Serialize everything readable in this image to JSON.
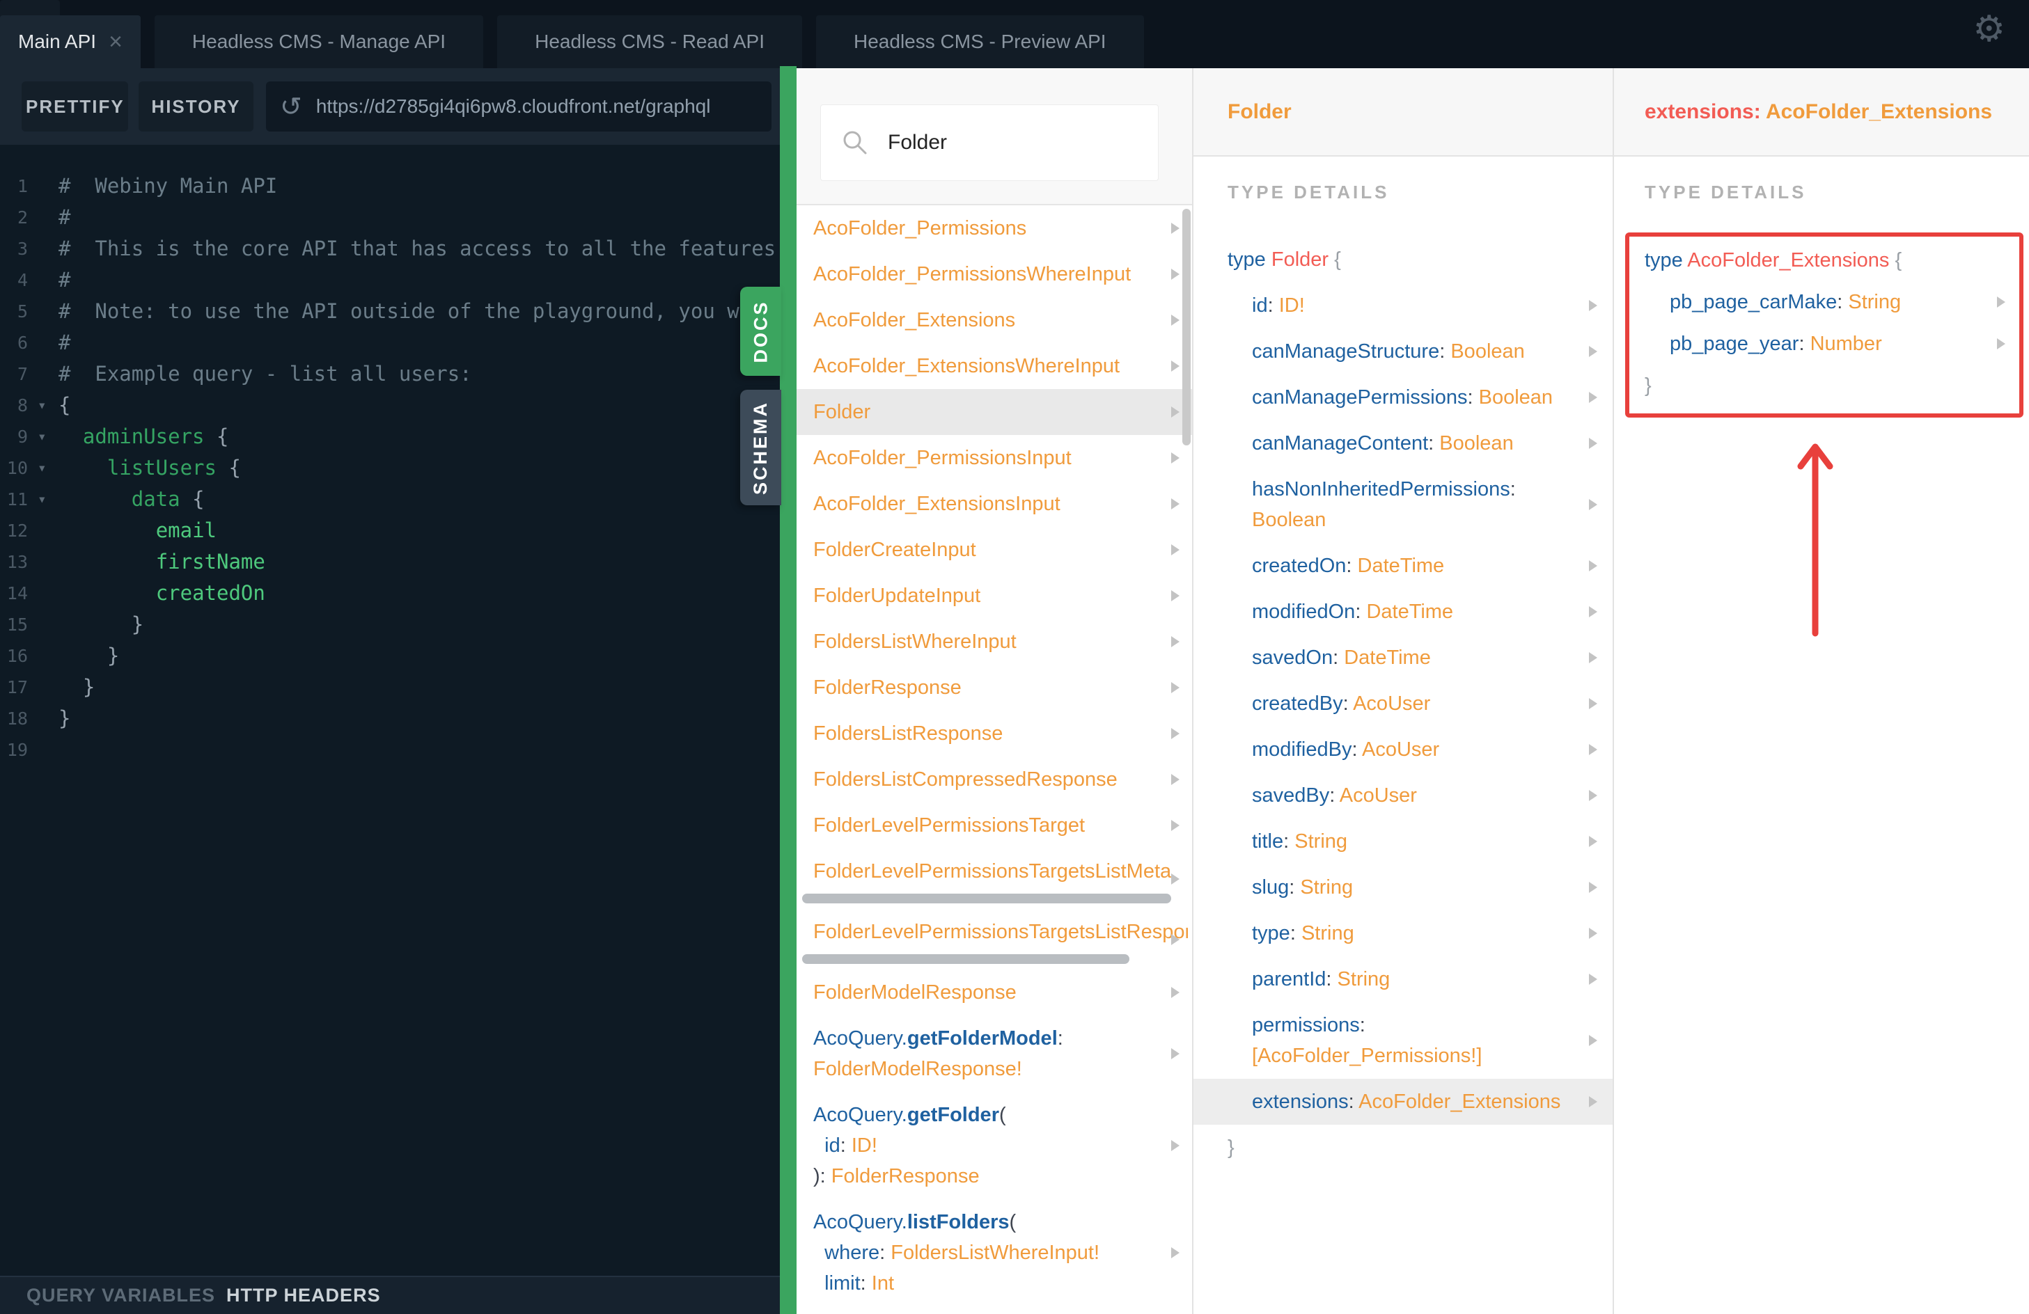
{
  "colors": {
    "accent_green": "#3ba55f",
    "annotation_red": "#e8403c",
    "type_orange": "#f09b3c",
    "field_blue": "#1f61a0",
    "type_salmon": "#f25c54",
    "selected_row_gray": "#e9e9e9"
  },
  "icons": {
    "gear": "⚙",
    "close": "×",
    "plus": "+",
    "reload": "↺",
    "fold_arrow": "▾",
    "search": "search-icon",
    "chevron": "chevron-right-icon"
  },
  "tabs": {
    "items": [
      {
        "label": "Main API",
        "active": true
      },
      {
        "label": "Headless CMS - Manage API",
        "active": false
      },
      {
        "label": "Headless CMS - Read API",
        "active": false
      },
      {
        "label": "Headless CMS - Preview API",
        "active": false
      }
    ]
  },
  "toolbar": {
    "prettify": "PRETTIFY",
    "history": "HISTORY",
    "url": "https://d2785gi4qi6pw8.cloudfront.net/graphql"
  },
  "editor": {
    "lines": [
      {
        "n": "1",
        "segs": [
          {
            "t": "#  Webiny Main API",
            "c": "com"
          }
        ]
      },
      {
        "n": "2",
        "segs": [
          {
            "t": "#",
            "c": "com"
          }
        ]
      },
      {
        "n": "3",
        "segs": [
          {
            "t": "#  This is the core API that has access to all the features",
            "c": "com"
          }
        ]
      },
      {
        "n": "4",
        "segs": [
          {
            "t": "#",
            "c": "com"
          }
        ]
      },
      {
        "n": "5",
        "segs": [
          {
            "t": "#  Note: to use the API outside of the playground, you w",
            "c": "com"
          }
        ]
      },
      {
        "n": "6",
        "segs": [
          {
            "t": "#",
            "c": "com"
          }
        ]
      },
      {
        "n": "7",
        "segs": [
          {
            "t": "#  Example query - list all users:",
            "c": "com"
          }
        ]
      },
      {
        "n": "8",
        "fold": true,
        "segs": [
          {
            "t": "{",
            "c": "brc"
          }
        ]
      },
      {
        "n": "9",
        "fold": true,
        "segs": [
          {
            "t": "  ",
            "c": "brc"
          },
          {
            "t": "adminUsers",
            "c": "fld"
          },
          {
            "t": " {",
            "c": "brc"
          }
        ]
      },
      {
        "n": "10",
        "fold": true,
        "segs": [
          {
            "t": "    ",
            "c": "brc"
          },
          {
            "t": "listUsers",
            "c": "fld"
          },
          {
            "t": " {",
            "c": "brc"
          }
        ]
      },
      {
        "n": "11",
        "fold": true,
        "segs": [
          {
            "t": "      ",
            "c": "brc"
          },
          {
            "t": "data",
            "c": "fld"
          },
          {
            "t": " {",
            "c": "brc"
          }
        ]
      },
      {
        "n": "12",
        "segs": [
          {
            "t": "        ",
            "c": "brc"
          },
          {
            "t": "email",
            "c": "leaf"
          }
        ]
      },
      {
        "n": "13",
        "segs": [
          {
            "t": "        ",
            "c": "brc"
          },
          {
            "t": "firstName",
            "c": "leaf"
          }
        ]
      },
      {
        "n": "14",
        "segs": [
          {
            "t": "        ",
            "c": "brc"
          },
          {
            "t": "createdOn",
            "c": "leaf"
          }
        ]
      },
      {
        "n": "15",
        "segs": [
          {
            "t": "      }",
            "c": "brc"
          }
        ]
      },
      {
        "n": "16",
        "segs": [
          {
            "t": "    }",
            "c": "brc"
          }
        ]
      },
      {
        "n": "17",
        "segs": [
          {
            "t": "  }",
            "c": "brc"
          }
        ]
      },
      {
        "n": "18",
        "segs": [
          {
            "t": "}",
            "c": "brc"
          }
        ]
      },
      {
        "n": "19",
        "segs": []
      }
    ]
  },
  "footer": {
    "query_variables": "QUERY VARIABLES",
    "http_headers": "HTTP HEADERS"
  },
  "side_tabs": {
    "docs": "DOCS",
    "schema": "SCHEMA"
  },
  "docs_panel": {
    "search_value": "Folder",
    "items": [
      {
        "segs": [
          {
            "t": "AcoFolder_Permissions",
            "c": "o"
          }
        ]
      },
      {
        "segs": [
          {
            "t": "AcoFolder_PermissionsWhereInput",
            "c": "o"
          }
        ]
      },
      {
        "segs": [
          {
            "t": "AcoFolder_Extensions",
            "c": "o"
          }
        ]
      },
      {
        "segs": [
          {
            "t": "AcoFolder_ExtensionsWhereInput",
            "c": "o"
          }
        ]
      },
      {
        "selected": true,
        "segs": [
          {
            "t": "Folder",
            "c": "o"
          }
        ]
      },
      {
        "segs": [
          {
            "t": "AcoFolder_PermissionsInput",
            "c": "o"
          }
        ]
      },
      {
        "segs": [
          {
            "t": "AcoFolder_ExtensionsInput",
            "c": "o"
          }
        ]
      },
      {
        "segs": [
          {
            "t": "FolderCreateInput",
            "c": "o"
          }
        ]
      },
      {
        "segs": [
          {
            "t": "FolderUpdateInput",
            "c": "o"
          }
        ]
      },
      {
        "segs": [
          {
            "t": "FoldersListWhereInput",
            "c": "o"
          }
        ]
      },
      {
        "segs": [
          {
            "t": "FolderResponse",
            "c": "o"
          }
        ]
      },
      {
        "segs": [
          {
            "t": "FoldersListResponse",
            "c": "o"
          }
        ]
      },
      {
        "segs": [
          {
            "t": "FoldersListCompressedResponse",
            "c": "o"
          }
        ]
      },
      {
        "segs": [
          {
            "t": "FolderLevelPermissionsTarget",
            "c": "o"
          }
        ]
      },
      {
        "hscroll": true,
        "segs": [
          {
            "t": "FolderLevelPermissionsTargetsListMeta",
            "c": "o"
          }
        ]
      },
      {
        "hscroll": true,
        "hscroll_short": true,
        "segs": [
          {
            "t": "FolderLevelPermissionsTargetsListResponse",
            "c": "o"
          }
        ]
      },
      {
        "segs": [
          {
            "t": "FolderModelResponse",
            "c": "o"
          }
        ]
      },
      {
        "segs": [
          {
            "t": "AcoQuery.",
            "c": "b"
          },
          {
            "t": "getFolderModel",
            "c": "bb"
          },
          {
            "t": ":",
            "c": "d"
          },
          {
            "t": "\n",
            "c": "d"
          },
          {
            "t": "FolderModelResponse!",
            "c": "o"
          }
        ]
      },
      {
        "segs": [
          {
            "t": "AcoQuery.",
            "c": "b"
          },
          {
            "t": "getFolder",
            "c": "bb"
          },
          {
            "t": "(",
            "c": "d"
          },
          {
            "t": "\n  ",
            "c": "d"
          },
          {
            "t": "id",
            "c": "b"
          },
          {
            "t": ": ",
            "c": "d"
          },
          {
            "t": "ID!",
            "c": "o"
          },
          {
            "t": "\n",
            "c": "d"
          },
          {
            "t": "): ",
            "c": "d"
          },
          {
            "t": "FolderResponse",
            "c": "o"
          }
        ]
      },
      {
        "segs": [
          {
            "t": "AcoQuery.",
            "c": "b"
          },
          {
            "t": "listFolders",
            "c": "bb"
          },
          {
            "t": "(",
            "c": "d"
          },
          {
            "t": "\n  ",
            "c": "d"
          },
          {
            "t": "where",
            "c": "b"
          },
          {
            "t": ": ",
            "c": "d"
          },
          {
            "t": "FoldersListWhereInput!",
            "c": "o"
          },
          {
            "t": "\n  ",
            "c": "d"
          },
          {
            "t": "limit",
            "c": "b"
          },
          {
            "t": ": ",
            "c": "d"
          },
          {
            "t": "Int",
            "c": "o"
          }
        ]
      }
    ]
  },
  "folder_panel": {
    "header": [
      {
        "t": "Folder",
        "c": "ob"
      }
    ],
    "section_label": "TYPE DETAILS",
    "lines": [
      {
        "segs": [
          {
            "t": "type ",
            "c": "b"
          },
          {
            "t": "Folder ",
            "c": "s"
          },
          {
            "t": "{",
            "c": "g"
          }
        ]
      },
      {
        "indent": true,
        "arrow": true,
        "segs": [
          {
            "t": "id",
            "c": "b"
          },
          {
            "t": ": ",
            "c": "d"
          },
          {
            "t": "ID!",
            "c": "o"
          }
        ]
      },
      {
        "indent": true,
        "arrow": true,
        "segs": [
          {
            "t": "canManageStructure",
            "c": "b"
          },
          {
            "t": ": ",
            "c": "d"
          },
          {
            "t": "Boolean",
            "c": "o"
          }
        ]
      },
      {
        "indent": true,
        "arrow": true,
        "segs": [
          {
            "t": "canManagePermissions",
            "c": "b"
          },
          {
            "t": ": ",
            "c": "d"
          },
          {
            "t": "Boolean",
            "c": "o"
          }
        ]
      },
      {
        "indent": true,
        "arrow": true,
        "segs": [
          {
            "t": "canManageContent",
            "c": "b"
          },
          {
            "t": ": ",
            "c": "d"
          },
          {
            "t": "Boolean",
            "c": "o"
          }
        ]
      },
      {
        "indent": true,
        "arrow": true,
        "segs": [
          {
            "t": "hasNonInheritedPermissions",
            "c": "b"
          },
          {
            "t": ":",
            "c": "d"
          },
          {
            "t": "\n",
            "c": "d"
          },
          {
            "t": "Boolean",
            "c": "o"
          }
        ]
      },
      {
        "indent": true,
        "arrow": true,
        "segs": [
          {
            "t": "createdOn",
            "c": "b"
          },
          {
            "t": ": ",
            "c": "d"
          },
          {
            "t": "DateTime",
            "c": "o"
          }
        ]
      },
      {
        "indent": true,
        "arrow": true,
        "segs": [
          {
            "t": "modifiedOn",
            "c": "b"
          },
          {
            "t": ": ",
            "c": "d"
          },
          {
            "t": "DateTime",
            "c": "o"
          }
        ]
      },
      {
        "indent": true,
        "arrow": true,
        "segs": [
          {
            "t": "savedOn",
            "c": "b"
          },
          {
            "t": ": ",
            "c": "d"
          },
          {
            "t": "DateTime",
            "c": "o"
          }
        ]
      },
      {
        "indent": true,
        "arrow": true,
        "segs": [
          {
            "t": "createdBy",
            "c": "b"
          },
          {
            "t": ": ",
            "c": "d"
          },
          {
            "t": "AcoUser",
            "c": "o"
          }
        ]
      },
      {
        "indent": true,
        "arrow": true,
        "segs": [
          {
            "t": "modifiedBy",
            "c": "b"
          },
          {
            "t": ": ",
            "c": "d"
          },
          {
            "t": "AcoUser",
            "c": "o"
          }
        ]
      },
      {
        "indent": true,
        "arrow": true,
        "segs": [
          {
            "t": "savedBy",
            "c": "b"
          },
          {
            "t": ": ",
            "c": "d"
          },
          {
            "t": "AcoUser",
            "c": "o"
          }
        ]
      },
      {
        "indent": true,
        "arrow": true,
        "segs": [
          {
            "t": "title",
            "c": "b"
          },
          {
            "t": ": ",
            "c": "d"
          },
          {
            "t": "String",
            "c": "o"
          }
        ]
      },
      {
        "indent": true,
        "arrow": true,
        "segs": [
          {
            "t": "slug",
            "c": "b"
          },
          {
            "t": ": ",
            "c": "d"
          },
          {
            "t": "String",
            "c": "o"
          }
        ]
      },
      {
        "indent": true,
        "arrow": true,
        "segs": [
          {
            "t": "type",
            "c": "b"
          },
          {
            "t": ": ",
            "c": "d"
          },
          {
            "t": "String",
            "c": "o"
          }
        ]
      },
      {
        "indent": true,
        "arrow": true,
        "segs": [
          {
            "t": "parentId",
            "c": "b"
          },
          {
            "t": ": ",
            "c": "d"
          },
          {
            "t": "String",
            "c": "o"
          }
        ]
      },
      {
        "indent": true,
        "arrow": true,
        "segs": [
          {
            "t": "permissions",
            "c": "b"
          },
          {
            "t": ":",
            "c": "d"
          },
          {
            "t": "\n",
            "c": "d"
          },
          {
            "t": "[AcoFolder_Permissions!]",
            "c": "o"
          }
        ]
      },
      {
        "indent": true,
        "arrow": true,
        "selected": true,
        "segs": [
          {
            "t": "extensions",
            "c": "b"
          },
          {
            "t": ": ",
            "c": "d"
          },
          {
            "t": "AcoFolder_Extensions",
            "c": "o"
          }
        ]
      },
      {
        "segs": [
          {
            "t": "}",
            "c": "g"
          }
        ]
      }
    ]
  },
  "extensions_panel": {
    "header": [
      {
        "t": "extensions",
        "c": "sb"
      },
      {
        "t": ": ",
        "c": "sb"
      },
      {
        "t": "AcoFolder_Extensions",
        "c": "ob"
      }
    ],
    "section_label": "TYPE DETAILS",
    "lines": [
      {
        "segs": [
          {
            "t": "type ",
            "c": "b"
          },
          {
            "t": "AcoFolder_Extensions ",
            "c": "s"
          },
          {
            "t": "{",
            "c": "g"
          }
        ]
      },
      {
        "indent": true,
        "arrow": true,
        "segs": [
          {
            "t": "pb_page_carMake",
            "c": "b"
          },
          {
            "t": ": ",
            "c": "d"
          },
          {
            "t": "String",
            "c": "o"
          }
        ]
      },
      {
        "indent": true,
        "arrow": true,
        "segs": [
          {
            "t": "pb_page_year",
            "c": "b"
          },
          {
            "t": ": ",
            "c": "d"
          },
          {
            "t": "Number",
            "c": "o"
          }
        ]
      },
      {
        "segs": [
          {
            "t": "}",
            "c": "g"
          }
        ]
      }
    ]
  }
}
